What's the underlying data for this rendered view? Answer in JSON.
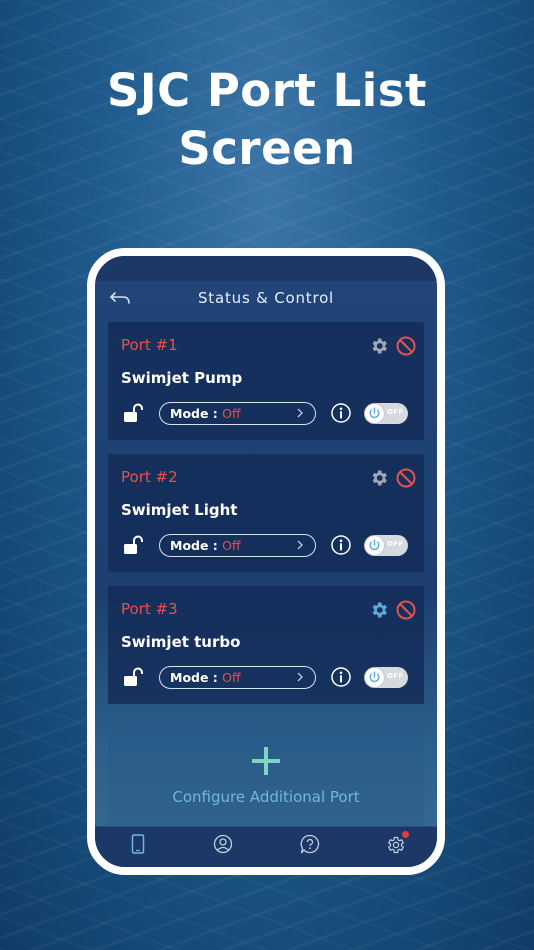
{
  "headline": {
    "line1": "SJC Port List",
    "line2": "Screen"
  },
  "topbar": {
    "title": "Status & Control",
    "back_icon": "back-arrow-icon"
  },
  "ports": [
    {
      "port_label": "Port #1",
      "device": "Swimjet Pump",
      "mode_label": "Mode :",
      "mode_value": "Off",
      "toggle_text": "OFF",
      "gear_active": false
    },
    {
      "port_label": "Port #2",
      "device": "Swimjet Light",
      "mode_label": "Mode :",
      "mode_value": "Off",
      "toggle_text": "OFF",
      "gear_active": false
    },
    {
      "port_label": "Port #3",
      "device": "Swimjet turbo",
      "mode_label": "Mode :",
      "mode_value": "Off",
      "toggle_text": "OFF",
      "gear_active": true
    }
  ],
  "add_port": {
    "label": "Configure Additional Port",
    "icon": "plus-icon"
  },
  "bottom_nav": [
    {
      "name": "device-icon",
      "active": true
    },
    {
      "name": "profile-icon",
      "active": false
    },
    {
      "name": "help-icon",
      "active": false
    },
    {
      "name": "settings-icon",
      "active": false,
      "badge": true
    }
  ],
  "colors": {
    "accent_red": "#e5524e",
    "accent_blue": "#6fb7e0",
    "gear_default": "#9ea7b3",
    "gear_active": "#5fa9dd",
    "card_bg": "#142d58"
  }
}
